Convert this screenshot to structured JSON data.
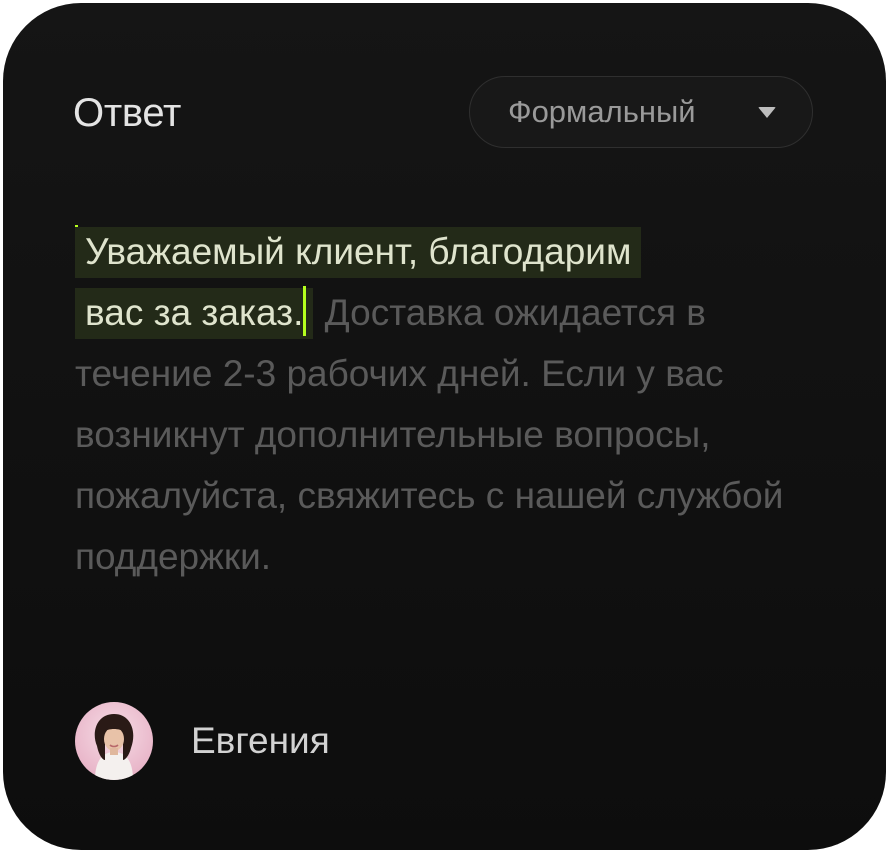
{
  "header": {
    "title": "Ответ",
    "tone_dropdown": {
      "selected": "Формальный",
      "icon": "caret-down-icon"
    }
  },
  "response": {
    "highlighted_line1": "Уважаемый клиент, благодарим",
    "highlighted_line2": "вас за заказ.",
    "remaining": " Доставка ожидается в течение 2-3 рабочих дней. Если у вас возникнут дополнительные вопросы, пожалуйста, свяжитесь с нашей службой поддержки."
  },
  "author": {
    "name": "Евгения",
    "avatar": "user-avatar"
  },
  "colors": {
    "card_background": "#111111",
    "cursor_accent": "#b5ff1e",
    "highlight_background": "#232a18",
    "muted_text": "#5a5a5a"
  }
}
